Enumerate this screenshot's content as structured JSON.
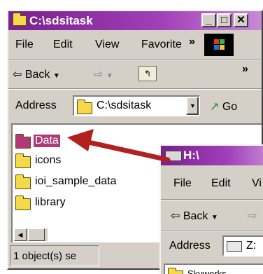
{
  "window1": {
    "title": "C:\\sdsitask",
    "menu": [
      "File",
      "Edit",
      "View",
      "Favorite",
      "»"
    ],
    "toolbar": {
      "back_label": "Back",
      "more": "»"
    },
    "address": {
      "label": "Address",
      "value": "C:\\sdsitask",
      "go_label": "Go"
    },
    "items": [
      {
        "label": "Data",
        "selected": true
      },
      {
        "label": "icons"
      },
      {
        "label": "ioi_sample_data"
      },
      {
        "label": "library"
      }
    ],
    "status": "1 object(s) se"
  },
  "window2": {
    "title": "H:\\",
    "menu": [
      "File",
      "Edit",
      "Vi"
    ],
    "toolbar": {
      "back_label": "Back"
    },
    "address": {
      "label": "Address",
      "value": "Z:"
    },
    "items": [
      {
        "label": "Skyworks"
      }
    ]
  },
  "colors": {
    "titlebar": "#7a1f8e",
    "selected_folder": "#b03a78",
    "arrow": "#b22020",
    "folder": "#f5d94a"
  }
}
